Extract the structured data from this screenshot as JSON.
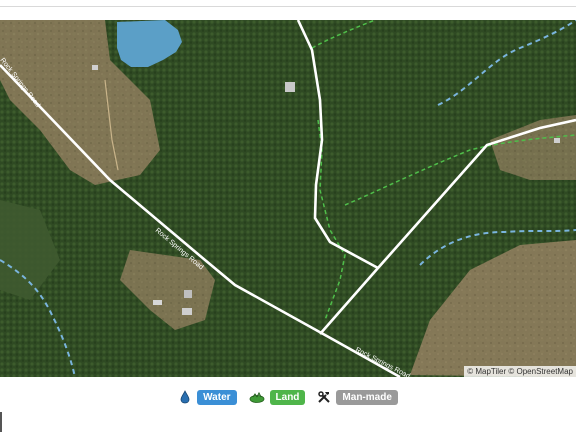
{
  "map": {
    "attribution": "© MapTiler © OpenStreetMap",
    "road_label_1": "Rock Springs Road",
    "road_label_2": "Rock Springs Road",
    "road_label_3": "Rock Springs Road"
  },
  "legend": {
    "items": [
      {
        "label": "Water",
        "icon": "water-drop-icon",
        "color": "#3b8fd6"
      },
      {
        "label": "Land",
        "icon": "land-icon",
        "color": "#4fb54a"
      },
      {
        "label": "Man-made",
        "icon": "tools-icon",
        "color": "#9a9a9a"
      }
    ]
  }
}
